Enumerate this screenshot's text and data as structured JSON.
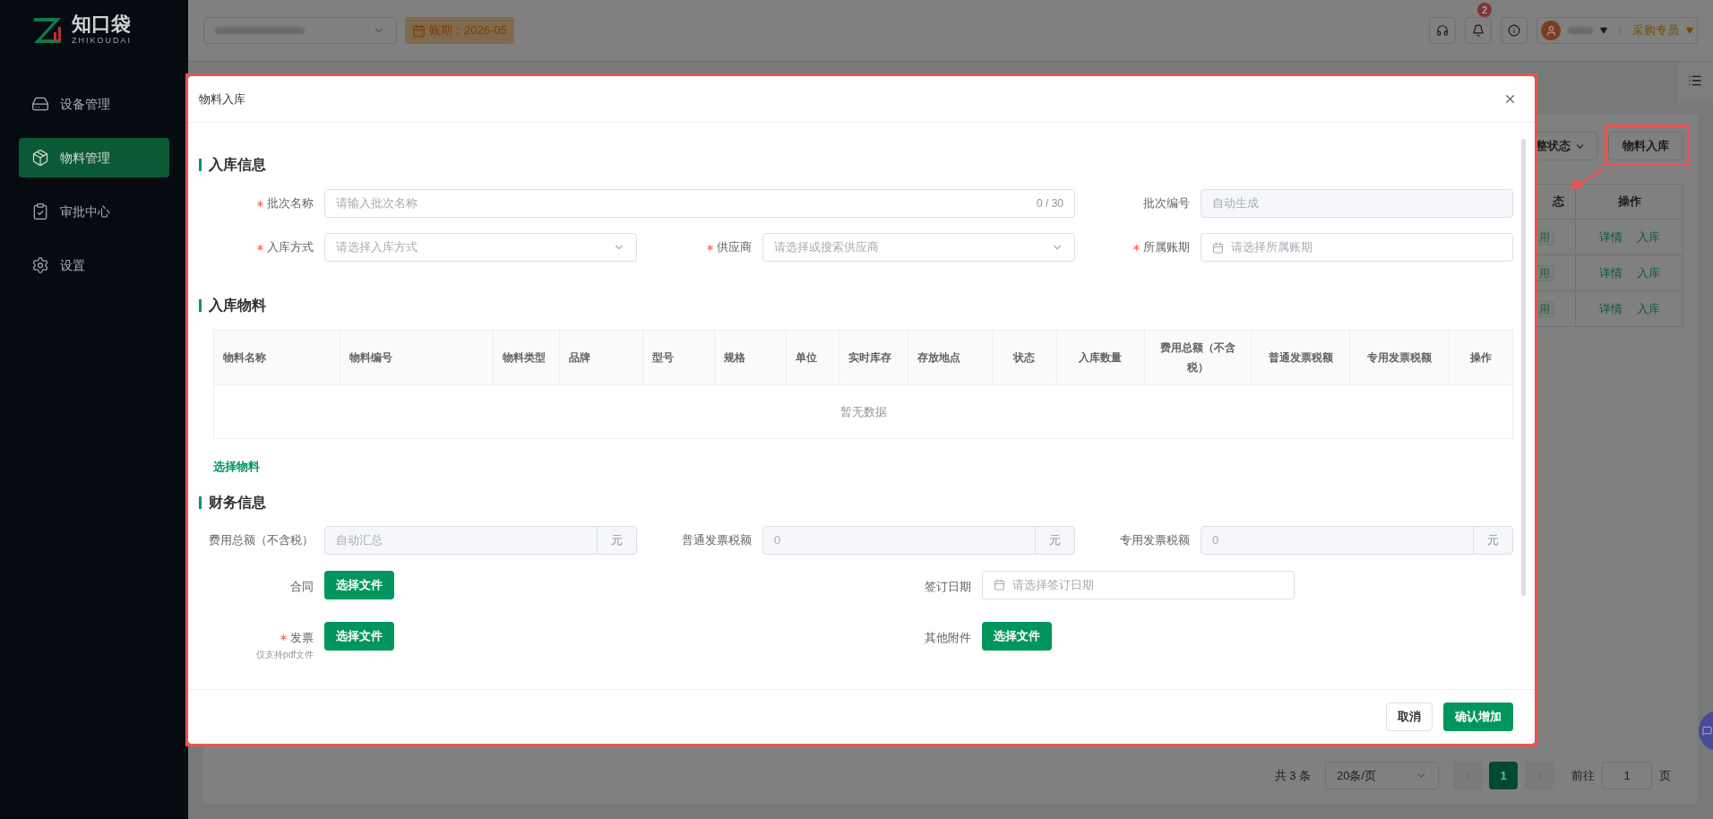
{
  "sidebar": {
    "logo": {
      "name": "知口袋",
      "subtitle": "ZHIKOUDAI"
    },
    "items": [
      {
        "label": "设备管理",
        "selected": false
      },
      {
        "label": "物料管理",
        "selected": true
      },
      {
        "label": "审批中心",
        "selected": false
      },
      {
        "label": "设置",
        "selected": false
      }
    ]
  },
  "header": {
    "period_badge": "账期：2026-05",
    "notification_count": "2",
    "role": "采购专员"
  },
  "background_page": {
    "filter_button": "整状态",
    "primary_button": "物料入库",
    "table": {
      "columns": [
        "态",
        "操作"
      ],
      "rows": [
        {
          "status": "用",
          "actions": [
            "详情",
            "入库"
          ]
        },
        {
          "status": "用",
          "actions": [
            "详情",
            "入库"
          ]
        },
        {
          "status": "用",
          "actions": [
            "详情",
            "入库"
          ]
        }
      ]
    },
    "pagination": {
      "total": "共 3 条",
      "page_size": "20条/页",
      "pages": [
        {
          "label": "1",
          "selected": true
        }
      ],
      "goto_label": "前往",
      "goto_value": "1",
      "goto_suffix": "页"
    }
  },
  "dialog": {
    "title": "物料入库",
    "basic_info": {
      "heading": "入库信息",
      "fields": [
        {
          "label": "批次名称",
          "required": true,
          "kind": "text",
          "placeholder": "请输入批次名称",
          "counter": "0 / 30"
        },
        {
          "label": "批次编号",
          "required": false,
          "kind": "readonly",
          "placeholder": "自动生成"
        },
        {
          "label": "入库方式",
          "required": true,
          "kind": "select",
          "placeholder": "请选择入库方式"
        },
        {
          "label": "供应商",
          "required": true,
          "kind": "select",
          "placeholder": "请选择或搜索供应商"
        },
        {
          "label": "所属账期",
          "required": true,
          "kind": "date",
          "placeholder": "请选择所属账期"
        }
      ]
    },
    "materials": {
      "heading": "入库物料",
      "table": {
        "columns": [
          "物料名称",
          "物料编号",
          "物料类型",
          "品牌",
          "型号",
          "规格",
          "单位",
          "实时库存",
          "存放地点",
          "状态",
          "入库数量",
          "费用总额（不含税）",
          "普通发票税额",
          "专用发票税额",
          "操作"
        ],
        "empty_text": "暂无数据"
      },
      "add_link": "选择物料"
    },
    "finance": {
      "heading": "财务信息",
      "amounts": [
        {
          "label": "费用总额（不含税）",
          "placeholder": "自动汇总",
          "unit": "元"
        },
        {
          "label": "普通发票税额",
          "value": "0",
          "unit": "元"
        },
        {
          "label": "专用发票税额",
          "value": "0",
          "unit": "元"
        }
      ],
      "attachments": [
        {
          "label": "合同",
          "required": false,
          "kind": "upload",
          "button": "选择文件"
        },
        {
          "label": "签订日期",
          "required": false,
          "kind": "date",
          "placeholder": "请选择签订日期"
        },
        {
          "label": "发票",
          "required": true,
          "kind": "upload",
          "button": "选择文件",
          "hint": "仅支持pdf文件"
        },
        {
          "label": "其他附件",
          "required": false,
          "kind": "upload",
          "button": "选择文件"
        }
      ]
    },
    "footer": {
      "buttons": [
        {
          "label": "取消",
          "kind": "default"
        },
        {
          "label": "确认增加",
          "kind": "primary"
        }
      ]
    }
  }
}
